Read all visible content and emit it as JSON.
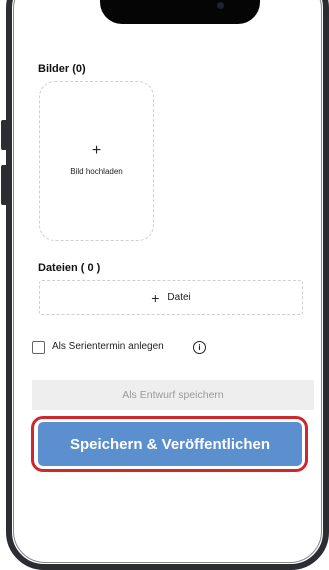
{
  "images": {
    "label": "Bilder (0)",
    "upload_plus": "+",
    "upload_label": "Bild hochladen"
  },
  "files": {
    "label": "Dateien ( 0 )",
    "add_plus": "+",
    "add_label": "Datei"
  },
  "recurring": {
    "label": "Als Serientermin anlegen",
    "checked": false,
    "info_glyph": "i"
  },
  "buttons": {
    "draft": "Als Entwurf speichern",
    "publish": "Speichern & Veröffentlichen"
  },
  "colors": {
    "primary": "#5b8fce",
    "highlight": "#d0272d",
    "disabled_bg": "#eeeeee",
    "disabled_text": "#9a9a9a"
  }
}
